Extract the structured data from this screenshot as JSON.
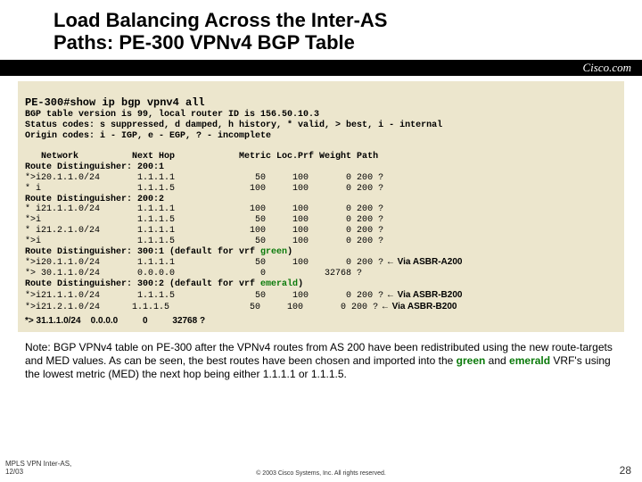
{
  "title": {
    "line1": "Load Balancing Across the Inter-AS",
    "line2": "Paths: PE-300 VPNv4 BGP Table"
  },
  "brand": "Cisco.com",
  "terminal": {
    "command": "PE-300#show ip bgp vpnv4 all",
    "header1": "BGP table version is 99, local router ID is 156.50.10.3",
    "header2": "Status codes: s suppressed, d damped, h history, * valid, > best, i - internal",
    "header3": "Origin codes: i - IGP, e - EGP, ? - incomplete",
    "columns": "   Network          Next Hop            Metric Loc.Prf Weight Path",
    "rd1": "Route Distinguisher: 200:1",
    "r1": "*>i20.1.1.0/24       1.1.1.1               50     100       0 200 ?",
    "r2": "* i                  1.1.1.5              100     100       0 200 ?",
    "rd2": "Route Distinguisher: 200:2",
    "r3": "* i21.1.1.0/24       1.1.1.1              100     100       0 200 ?",
    "r4": "*>i                  1.1.1.5               50     100       0 200 ?",
    "r5": "* i21.2.1.0/24       1.1.1.1              100     100       0 200 ?",
    "r6": "*>i                  1.1.1.5               50     100       0 200 ?",
    "rd3a": "Route Distinguisher: 300:1 (default for vrf ",
    "rd3b": "green",
    "rd3c": ")",
    "r7": "*>i20.1.1.0/24       1.1.1.1               50     100       0 200 ?",
    "a1": "Via ASBR-A200",
    "r8": "*> 30.1.1.0/24       0.0.0.0                0           32768 ?",
    "rd4a": "Route Distinguisher: 300:2 (default for vrf ",
    "rd4b": "emerald",
    "rd4c": ")",
    "r9": "*>i21.1.1.0/24       1.1.1.5               50     100       0 200 ?",
    "a2": "Via ASBR-B200",
    "r10": "*>i21.2.1.0/24      1.1.1.5               50     100       0 200 ?",
    "a3": "Via ASBR-B200",
    "extra": "*> 31.1.1.0/24    0.0.0.0          0          32768 ?"
  },
  "note": {
    "p1": "Note: BGP VPNv4 table on PE-300 after the VPNv4 routes from AS 200 have been redistributed using the new route-targets and MED values. As can be seen, the best routes have been chosen and imported into the ",
    "g1": "green",
    "p2": " and ",
    "g2": "emerald",
    "p3": " VRF's using the lowest metric (MED) the next hop being either 1.1.1.1 or 1.1.1.5."
  },
  "footer": {
    "left1": "MPLS VPN Inter-AS,",
    "left2": "12/03",
    "mid": "© 2003 Cisco Systems, Inc. All rights reserved.",
    "page": "28"
  }
}
